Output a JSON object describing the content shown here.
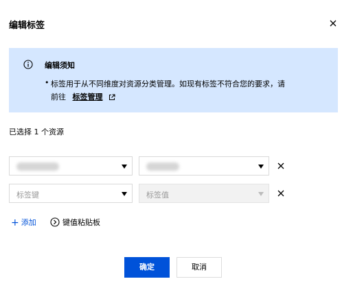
{
  "dialog": {
    "title": "编辑标签",
    "close_icon": "close-icon"
  },
  "notice": {
    "icon": "info-icon",
    "title": "编辑须知",
    "bullet": "•",
    "line1": "标签用于从不同维度对资源分类管理。如现有标签不符合您的要求，请",
    "line2_prefix": "前往",
    "link_label": "标签管理",
    "link_icon": "external-link-icon",
    "background": "#d5e7ff"
  },
  "selected": {
    "text": "已选择 1 个资源"
  },
  "tags": [
    {
      "key": "",
      "value": "",
      "key_placeholder": "标签键",
      "value_placeholder": "标签值",
      "key_redacted": true,
      "value_redacted": true,
      "value_disabled": false
    },
    {
      "key": "",
      "value": "",
      "key_placeholder": "标签键",
      "value_placeholder": "标签值",
      "key_redacted": false,
      "value_redacted": false,
      "value_disabled": true
    }
  ],
  "actions": {
    "add_label": "添加",
    "add_icon": "plus-icon",
    "kv_paste_label": "键值粘贴板",
    "kv_paste_icon": "chevron-circle-icon"
  },
  "footer": {
    "confirm_label": "确定",
    "cancel_label": "取消"
  },
  "colors": {
    "primary": "#0052d9",
    "notice_bg": "#d5e7ff"
  }
}
